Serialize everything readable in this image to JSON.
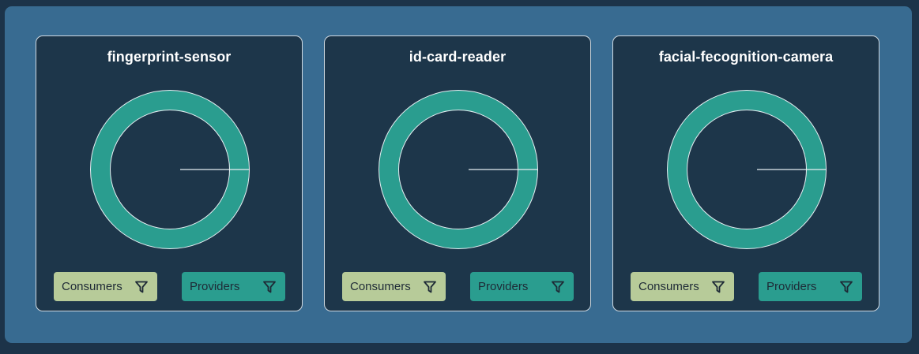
{
  "colors": {
    "page_background": "#1c3349",
    "panel_background": "#386b91",
    "card_background": "#1d364a",
    "donut_segment": "#2a9d8f",
    "consumers_button": "#b7cb99",
    "providers_button": "#2a9d8f"
  },
  "cards": [
    {
      "title": "fingerprint-sensor",
      "consumers_label": "Consumers",
      "providers_label": "Providers",
      "consumers_icon": "filter-icon",
      "providers_icon": "filter-icon"
    },
    {
      "title": "id-card-reader",
      "consumers_label": "Consumers",
      "providers_label": "Providers",
      "consumers_icon": "filter-icon",
      "providers_icon": "filter-icon"
    },
    {
      "title": "facial-fecognition-camera",
      "consumers_label": "Consumers",
      "providers_label": "Providers",
      "consumers_icon": "filter-icon",
      "providers_icon": "filter-icon"
    }
  ]
}
